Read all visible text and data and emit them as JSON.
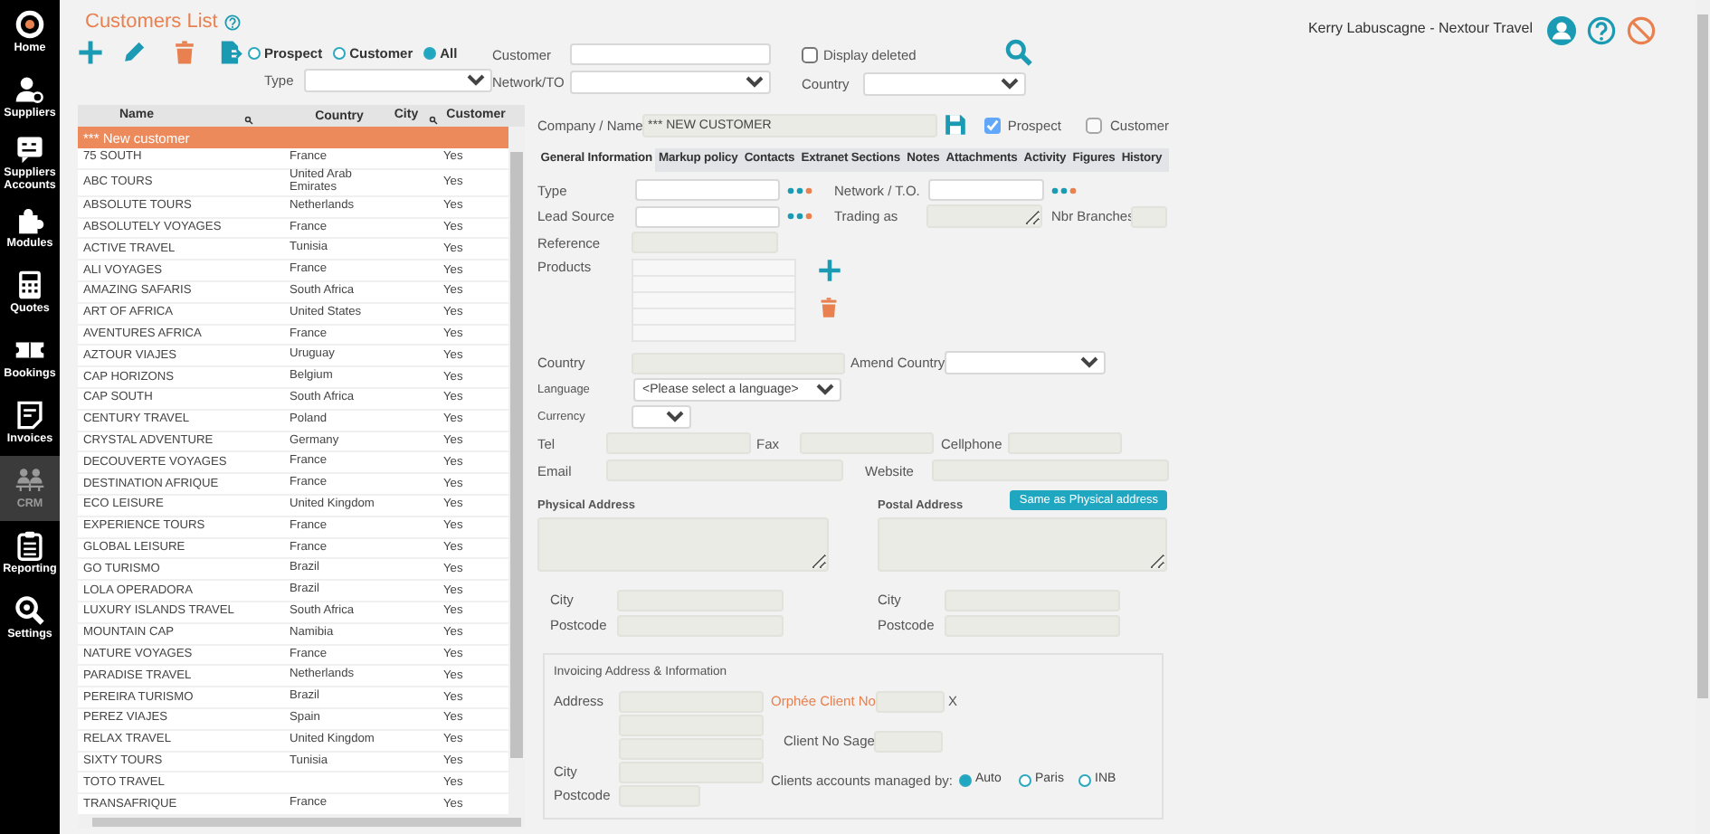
{
  "sidebar": {
    "items": [
      {
        "label": "Home",
        "selected": false
      },
      {
        "label": "Suppliers",
        "selected": false
      },
      {
        "label": "Suppliers Accounts",
        "selected": false
      },
      {
        "label": "Modules",
        "selected": false
      },
      {
        "label": "Quotes",
        "selected": false
      },
      {
        "label": "Bookings",
        "selected": false
      },
      {
        "label": "Invoices",
        "selected": false
      },
      {
        "label": "CRM",
        "selected": true
      },
      {
        "label": "Reporting",
        "selected": false
      },
      {
        "label": "Settings",
        "selected": false
      }
    ]
  },
  "header": {
    "title": "Customers List",
    "user": "Kerry Labuscagne - Nextour Travel"
  },
  "filters": {
    "status": [
      {
        "label": "Prospect",
        "selected": false
      },
      {
        "label": "Customer",
        "selected": false
      },
      {
        "label": "All",
        "selected": true
      }
    ],
    "type_label": "Type",
    "customer_label": "Customer",
    "network_label": "Network/TO",
    "display_deleted": {
      "label": "Display deleted",
      "checked": false
    },
    "country_label": "Country"
  },
  "customers": {
    "columns": [
      "Name",
      "Country",
      "City",
      "Customer"
    ],
    "new_row": "*** New customer",
    "rows": [
      {
        "name": "75 SOUTH",
        "country": "France",
        "customer": "Yes"
      },
      {
        "name": "ABC TOURS",
        "country": "United Arab Emirates",
        "customer": "Yes"
      },
      {
        "name": "ABSOLUTE TOURS",
        "country": "Netherlands",
        "customer": "Yes"
      },
      {
        "name": "ABSOLUTELY VOYAGES",
        "country": "France",
        "customer": "Yes"
      },
      {
        "name": "ACTIVE TRAVEL",
        "country": "Tunisia",
        "customer": "Yes"
      },
      {
        "name": "ALI VOYAGES",
        "country": "France",
        "customer": "Yes"
      },
      {
        "name": "AMAZING SAFARIS",
        "country": "South Africa",
        "customer": "Yes"
      },
      {
        "name": "ART OF AFRICA",
        "country": "United States",
        "customer": "Yes"
      },
      {
        "name": "AVENTURES AFRICA",
        "country": "France",
        "customer": "Yes"
      },
      {
        "name": "AZTOUR VIAJES",
        "country": "Uruguay",
        "customer": "Yes"
      },
      {
        "name": "CAP HORIZONS",
        "country": "Belgium",
        "customer": "Yes"
      },
      {
        "name": "CAP SOUTH",
        "country": "South Africa",
        "customer": "Yes"
      },
      {
        "name": "CENTURY TRAVEL",
        "country": "Poland",
        "customer": "Yes"
      },
      {
        "name": "CRYSTAL ADVENTURE",
        "country": "Germany",
        "customer": "Yes"
      },
      {
        "name": "DECOUVERTE VOYAGES",
        "country": "France",
        "customer": "Yes"
      },
      {
        "name": "DESTINATION AFRIQUE",
        "country": "France",
        "customer": "Yes"
      },
      {
        "name": "ECO LEISURE",
        "country": "United Kingdom",
        "customer": "Yes"
      },
      {
        "name": "EXPERIENCE TOURS",
        "country": "France",
        "customer": "Yes"
      },
      {
        "name": "GLOBAL LEISURE",
        "country": "France",
        "customer": "Yes"
      },
      {
        "name": "GO TURISMO",
        "country": "Brazil",
        "customer": "Yes"
      },
      {
        "name": "LOLA OPERADORA",
        "country": "Brazil",
        "customer": "Yes"
      },
      {
        "name": "LUXURY ISLANDS TRAVEL",
        "country": "South Africa",
        "customer": "Yes"
      },
      {
        "name": "MOUNTAIN CAP",
        "country": "Namibia",
        "customer": "Yes"
      },
      {
        "name": "NATURE VOYAGES",
        "country": "France",
        "customer": "Yes"
      },
      {
        "name": "PARADISE TRAVEL",
        "country": "Netherlands",
        "customer": "Yes"
      },
      {
        "name": "PEREIRA TURISMO",
        "country": "Brazil",
        "customer": "Yes"
      },
      {
        "name": "PEREZ VIAJES",
        "country": "Spain",
        "customer": "Yes"
      },
      {
        "name": "RELAX TRAVEL",
        "country": "United Kingdom",
        "customer": "Yes"
      },
      {
        "name": "SIXTY TOURS",
        "country": "Tunisia",
        "customer": "Yes"
      },
      {
        "name": "TOTO TRAVEL",
        "customer": "Yes"
      },
      {
        "name": "TRANSAFRIQUE",
        "country": "France",
        "customer": "Yes"
      }
    ]
  },
  "form": {
    "company_label": "Company / Name",
    "company_value": "*** NEW CUSTOMER",
    "flags": [
      {
        "label": "Prospect",
        "checked": true
      },
      {
        "label": "Customer",
        "checked": false
      }
    ],
    "tabs": [
      {
        "label": "General Information",
        "selected": true
      },
      {
        "label": "Markup policy",
        "selected": false
      },
      {
        "label": "Contacts",
        "selected": false
      },
      {
        "label": "Extranet Sections",
        "selected": false
      },
      {
        "label": "Notes",
        "selected": false
      },
      {
        "label": "Attachments",
        "selected": false
      },
      {
        "label": "Activity",
        "selected": false
      },
      {
        "label": "Figures",
        "selected": false
      },
      {
        "label": "History",
        "selected": false
      }
    ],
    "type_label": "Type",
    "network_label": "Network / T.O.",
    "lead_source_label": "Lead Source",
    "trading_as_label": "Trading as",
    "branches_label": "Nbr Branches",
    "reference_label": "Reference",
    "products_label": "Products",
    "country_label": "Country",
    "amend_country_label": "Amend Country",
    "language_label": "Language",
    "language_value": "<Please select a language>",
    "currency_label": "Currency",
    "tel_label": "Tel",
    "fax_label": "Fax",
    "cellphone_label": "Cellphone",
    "email_label": "Email",
    "website_label": "Website",
    "physical_address_label": "Physical Address",
    "postal_address_label": "Postal Address",
    "same_address_button": "Same as Physical address",
    "physical_city_label": "City",
    "physical_postcode_label": "Postcode",
    "postal_city_label": "City",
    "postal_postcode_label": "Postcode",
    "invoicing": {
      "title": "Invoicing Address & Information",
      "address_label": "Address",
      "city_label": "City",
      "postcode_label": "Postcode",
      "orphee_label": "Orphée Client No",
      "orphee_clear": "X",
      "sage_label": "Client No Sage",
      "managed_by_label": "Clients accounts managed by:",
      "managed_by": [
        {
          "label": "Auto",
          "selected": true
        },
        {
          "label": "Paris",
          "selected": false
        },
        {
          "label": "INB",
          "selected": false
        }
      ]
    }
  }
}
